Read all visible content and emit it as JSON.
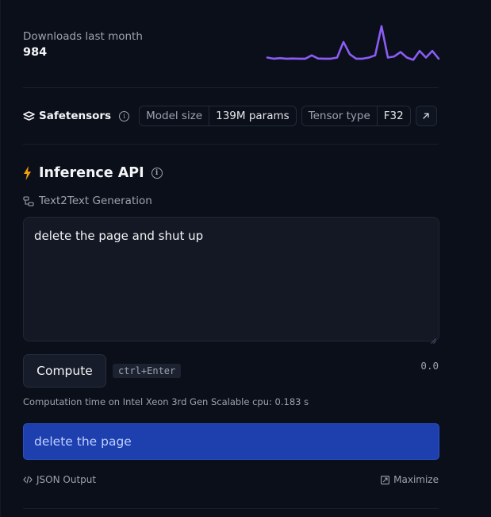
{
  "downloads": {
    "label": "Downloads last month",
    "value": "984",
    "sparkline_color": "#8b5cf6",
    "sparkline": [
      6,
      5,
      5.5,
      5,
      5.2,
      5,
      5,
      8,
      5.2,
      5,
      5,
      6,
      20,
      9,
      5,
      5,
      6,
      8,
      34,
      6,
      7,
      11,
      6,
      4,
      12,
      6,
      12,
      5
    ]
  },
  "safetensors": {
    "label": "Safetensors",
    "info_icon": "info-icon",
    "model_size_label": "Model size",
    "model_size_value": "139M params",
    "tensor_type_label": "Tensor type",
    "tensor_type_value": "F32",
    "open_icon": "arrow-up-right-icon"
  },
  "inference": {
    "title": "Inference API",
    "bolt_color": "#f59e0b",
    "task": "Text2Text Generation",
    "input_text": "delete the page and shut up",
    "compute_label": "Compute",
    "shortcut": "ctrl+Enter",
    "timer": "0.0",
    "computation_time": "Computation time on Intel Xeon 3rd Gen Scalable cpu: 0.183 s",
    "output_text": "delete the page",
    "output_bg": "#1e40af",
    "json_output_label": "JSON Output",
    "maximize_label": "Maximize"
  }
}
